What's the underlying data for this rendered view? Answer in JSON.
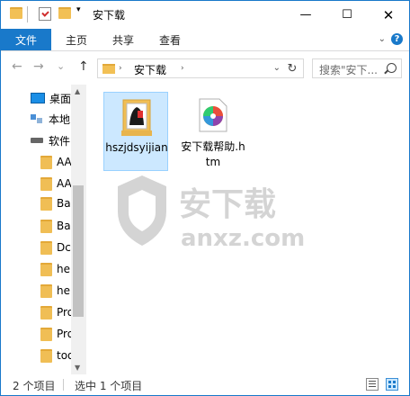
{
  "window": {
    "title": "安下载"
  },
  "ribbon": {
    "tabs": {
      "file": "文件",
      "home": "主页",
      "share": "共享",
      "view": "查看"
    },
    "help": "?"
  },
  "navigation": {
    "address_path": "安下载",
    "search_placeholder": "搜索\"安下...",
    "back": "←",
    "forward": "→",
    "recent": "⌄",
    "up": "↑",
    "refresh": "↻"
  },
  "sidebar": {
    "items": [
      {
        "label": "桌面",
        "icon": "desktop-icon"
      },
      {
        "label": "本地",
        "icon": "this-pc-icon"
      },
      {
        "label": "软件",
        "icon": "drive-icon"
      },
      {
        "label": "AA",
        "icon": "folder-icon"
      },
      {
        "label": "AA",
        "icon": "folder-icon"
      },
      {
        "label": "Ba",
        "icon": "folder-icon"
      },
      {
        "label": "Ba",
        "icon": "folder-icon"
      },
      {
        "label": "Dc",
        "icon": "folder-icon"
      },
      {
        "label": "he",
        "icon": "folder-icon"
      },
      {
        "label": "he",
        "icon": "folder-icon"
      },
      {
        "label": "Pro",
        "icon": "folder-icon"
      },
      {
        "label": "Pro",
        "icon": "folder-icon"
      },
      {
        "label": "too",
        "icon": "folder-icon"
      }
    ]
  },
  "files": [
    {
      "name": "hszjdsyijian",
      "selected": true,
      "icon": "folder-with-photo-icon"
    },
    {
      "name": "安下载帮助.htm",
      "selected": false,
      "icon": "colorful-html-icon"
    }
  ],
  "watermark": {
    "text_cn": "安下载",
    "text_en": "anxz.com"
  },
  "status": {
    "item_count": "2 个项目",
    "selection": "选中 1 个项目"
  },
  "colors": {
    "accent": "#1979ca",
    "selection_bg": "#cce8ff",
    "selection_border": "#99d1ff",
    "folder": "#f0be55"
  }
}
